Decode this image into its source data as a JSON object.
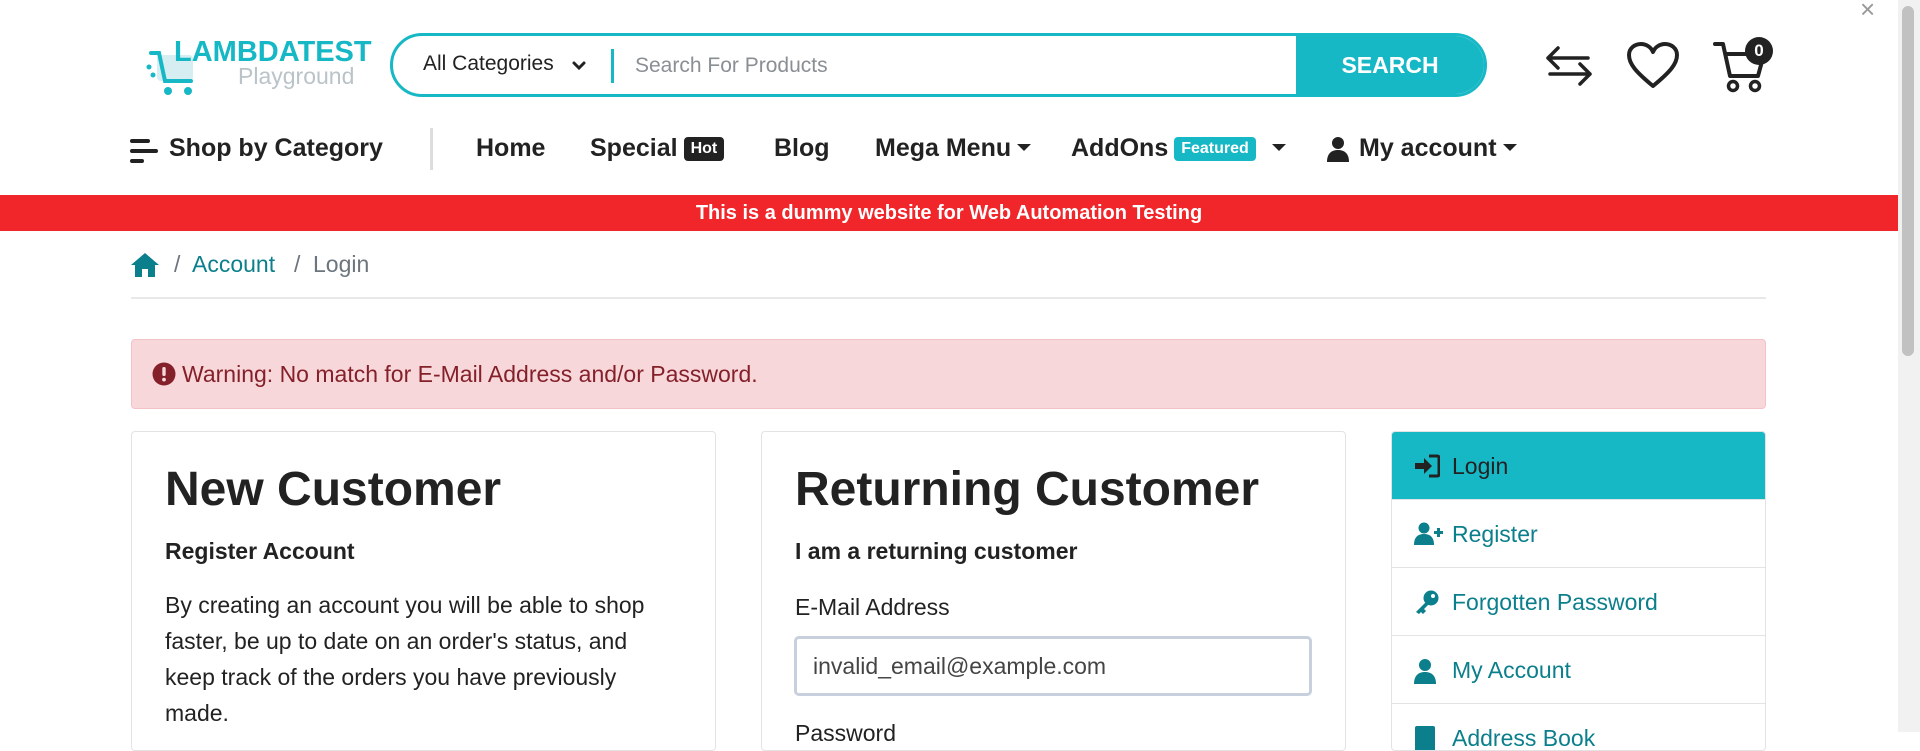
{
  "brand": {
    "name_line1": "LAMBDATEST",
    "name_line2": "Playground"
  },
  "search": {
    "category": "All Categories",
    "placeholder": "Search For Products",
    "button": "SEARCH"
  },
  "header_icons": {
    "compare": "compare-arrows-icon",
    "wishlist": "heart-icon",
    "cart": "cart-icon",
    "cart_count": "0"
  },
  "nav": {
    "shop_by_category": "Shop by Category",
    "items": [
      {
        "label": "Home"
      },
      {
        "label": "Special",
        "badge": "Hot"
      },
      {
        "label": "Blog"
      },
      {
        "label": "Mega Menu"
      },
      {
        "label": "AddOns",
        "badge": "Featured"
      },
      {
        "label": "My account"
      }
    ]
  },
  "banner": "This is a dummy website for Web Automation Testing",
  "breadcrumb": {
    "items": [
      "Account",
      "Login"
    ]
  },
  "alert": "Warning: No match for E-Mail Address and/or Password.",
  "new_customer": {
    "title": "New Customer",
    "subtitle": "Register Account",
    "text_lines": [
      "By creating an account you will be able to shop",
      "faster, be up to date on an order's status, and",
      "keep track of the orders you have previously",
      "made."
    ]
  },
  "returning_customer": {
    "title": "Returning Customer",
    "subtitle": "I am a returning customer",
    "email_label": "E-Mail Address",
    "email_value": "invalid_email@example.com",
    "password_label": "Password"
  },
  "sidebar": {
    "items": [
      {
        "label": "Login",
        "icon": "sign-in-icon"
      },
      {
        "label": "Register",
        "icon": "user-plus-icon"
      },
      {
        "label": "Forgotten Password",
        "icon": "key-icon"
      },
      {
        "label": "My Account",
        "icon": "user-icon"
      },
      {
        "label": "Address Book",
        "icon": "address-book-icon"
      }
    ]
  },
  "colors": {
    "accent": "#17b8c6",
    "banner": "#f1262b",
    "alert_bg": "#f8d7da",
    "link": "#0b7f8c"
  }
}
